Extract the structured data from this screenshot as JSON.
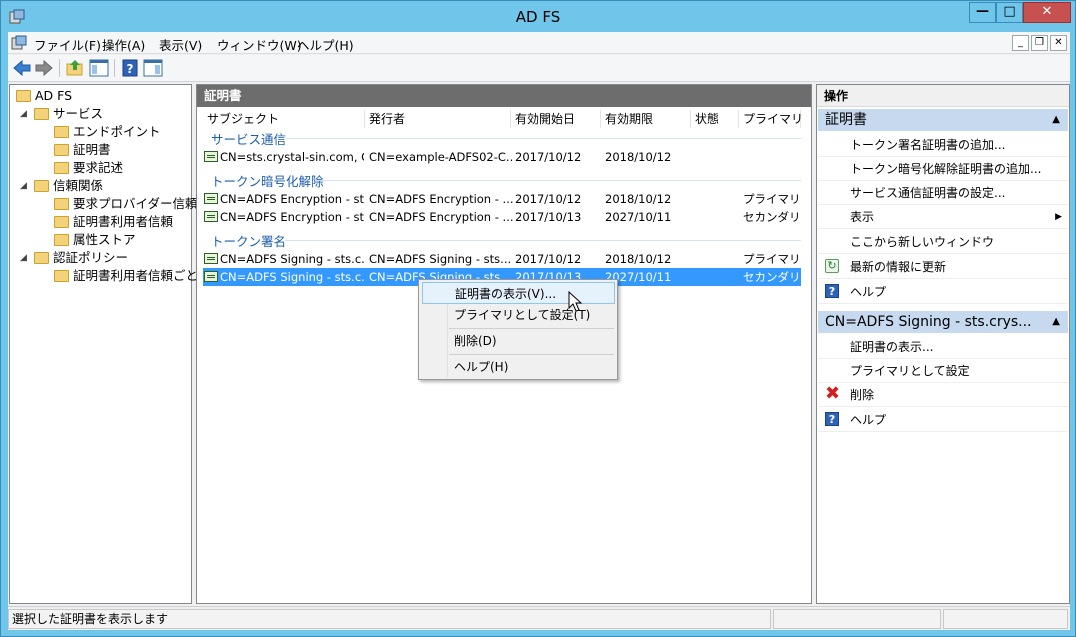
{
  "window": {
    "title": "AD FS"
  },
  "menu": [
    "ファイル(F)",
    "操作(A)",
    "表示(V)",
    "ウィンドウ(W)",
    "ヘルプ(H)"
  ],
  "tree": {
    "root": "AD FS",
    "items": [
      {
        "label": "サービス"
      },
      {
        "label": "エンドポイント"
      },
      {
        "label": "証明書"
      },
      {
        "label": "要求記述"
      },
      {
        "label": "信頼関係"
      },
      {
        "label": "要求プロバイダー信頼"
      },
      {
        "label": "証明書利用者信頼"
      },
      {
        "label": "属性ストア"
      },
      {
        "label": "認証ポリシー"
      },
      {
        "label": "証明書利用者信頼ごと"
      }
    ]
  },
  "center": {
    "title": "証明書",
    "columns": [
      "サブジェクト",
      "発行者",
      "有効開始日",
      "有効期限",
      "状態",
      "プライマリ"
    ],
    "groups": [
      {
        "label": "サービス通信",
        "rows": [
          {
            "subject": "CN=sts.crystal-sin.com, O...",
            "issuer": "CN=example-ADFS02-C...",
            "start": "2017/10/12",
            "end": "2018/10/12",
            "state": "",
            "primary": ""
          }
        ]
      },
      {
        "label": "トークン暗号化解除",
        "rows": [
          {
            "subject": "CN=ADFS Encryption - st...",
            "issuer": "CN=ADFS Encryption - ...",
            "start": "2017/10/12",
            "end": "2018/10/12",
            "state": "",
            "primary": "プライマリ"
          },
          {
            "subject": "CN=ADFS Encryption - st...",
            "issuer": "CN=ADFS Encryption - ...",
            "start": "2017/10/13",
            "end": "2027/10/11",
            "state": "",
            "primary": "セカンダリ"
          }
        ]
      },
      {
        "label": "トークン署名",
        "rows": [
          {
            "subject": "CN=ADFS Signing - sts.c...",
            "issuer": "CN=ADFS Signing - sts...",
            "start": "2017/10/12",
            "end": "2018/10/12",
            "state": "",
            "primary": "プライマリ"
          },
          {
            "subject": "CN=ADFS Signing - sts.c...",
            "issuer": "CN=ADFS Signing - sts...",
            "start": "2017/10/13",
            "end": "2027/10/11",
            "state": "",
            "primary": "セカンダリ"
          }
        ]
      }
    ]
  },
  "context_menu": {
    "items": [
      "証明書の表示(V)...",
      "プライマリとして設定(T)",
      "削除(D)",
      "ヘルプ(H)"
    ]
  },
  "actions": {
    "title": "操作",
    "section1": {
      "label": "証明書",
      "items": [
        "トークン署名証明書の追加...",
        "トークン暗号化解除証明書の追加...",
        "サービス通信証明書の設定...",
        "表示",
        "ここから新しいウィンドウ",
        "最新の情報に更新",
        "ヘルプ"
      ]
    },
    "section2": {
      "label": "CN=ADFS Signing - sts.crys...",
      "items": [
        "証明書の表示...",
        "プライマリとして設定",
        "削除",
        "ヘルプ"
      ]
    }
  },
  "status": {
    "text": "選択した証明書を表示します"
  },
  "colors": {
    "titlebar": "#6fc6ea",
    "selection": "#3399ff",
    "section_bg": "#c6d9ef",
    "group_text": "#1d5dad"
  }
}
